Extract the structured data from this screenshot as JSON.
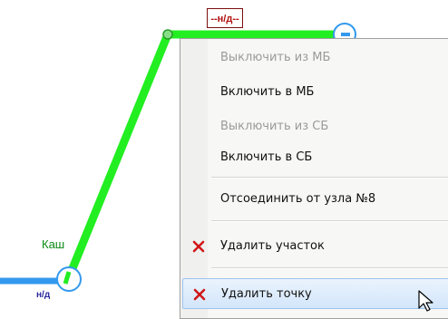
{
  "scheme": {
    "node_label": "Каш",
    "nd_tag": "--н/д--",
    "nd_small": "н/д",
    "line_color": "#22ee22",
    "pipe_color": "#3399ee"
  },
  "context_menu": {
    "items": [
      {
        "label": "Выключить из МБ",
        "enabled": false
      },
      {
        "label": "Включить в МБ",
        "enabled": true
      },
      {
        "label": "Выключить из СБ",
        "enabled": false
      },
      {
        "label": "Включить в СБ",
        "enabled": true
      },
      {
        "label": "Отсоединить от узла №8",
        "enabled": true
      },
      {
        "label": "Удалить участок",
        "enabled": true,
        "icon": "red-x-icon"
      },
      {
        "label": "Удалить точку",
        "enabled": true,
        "icon": "red-x-icon",
        "highlighted": true
      }
    ],
    "accent_delete": "#d01818",
    "hover_bg": "#d3e6fb"
  }
}
